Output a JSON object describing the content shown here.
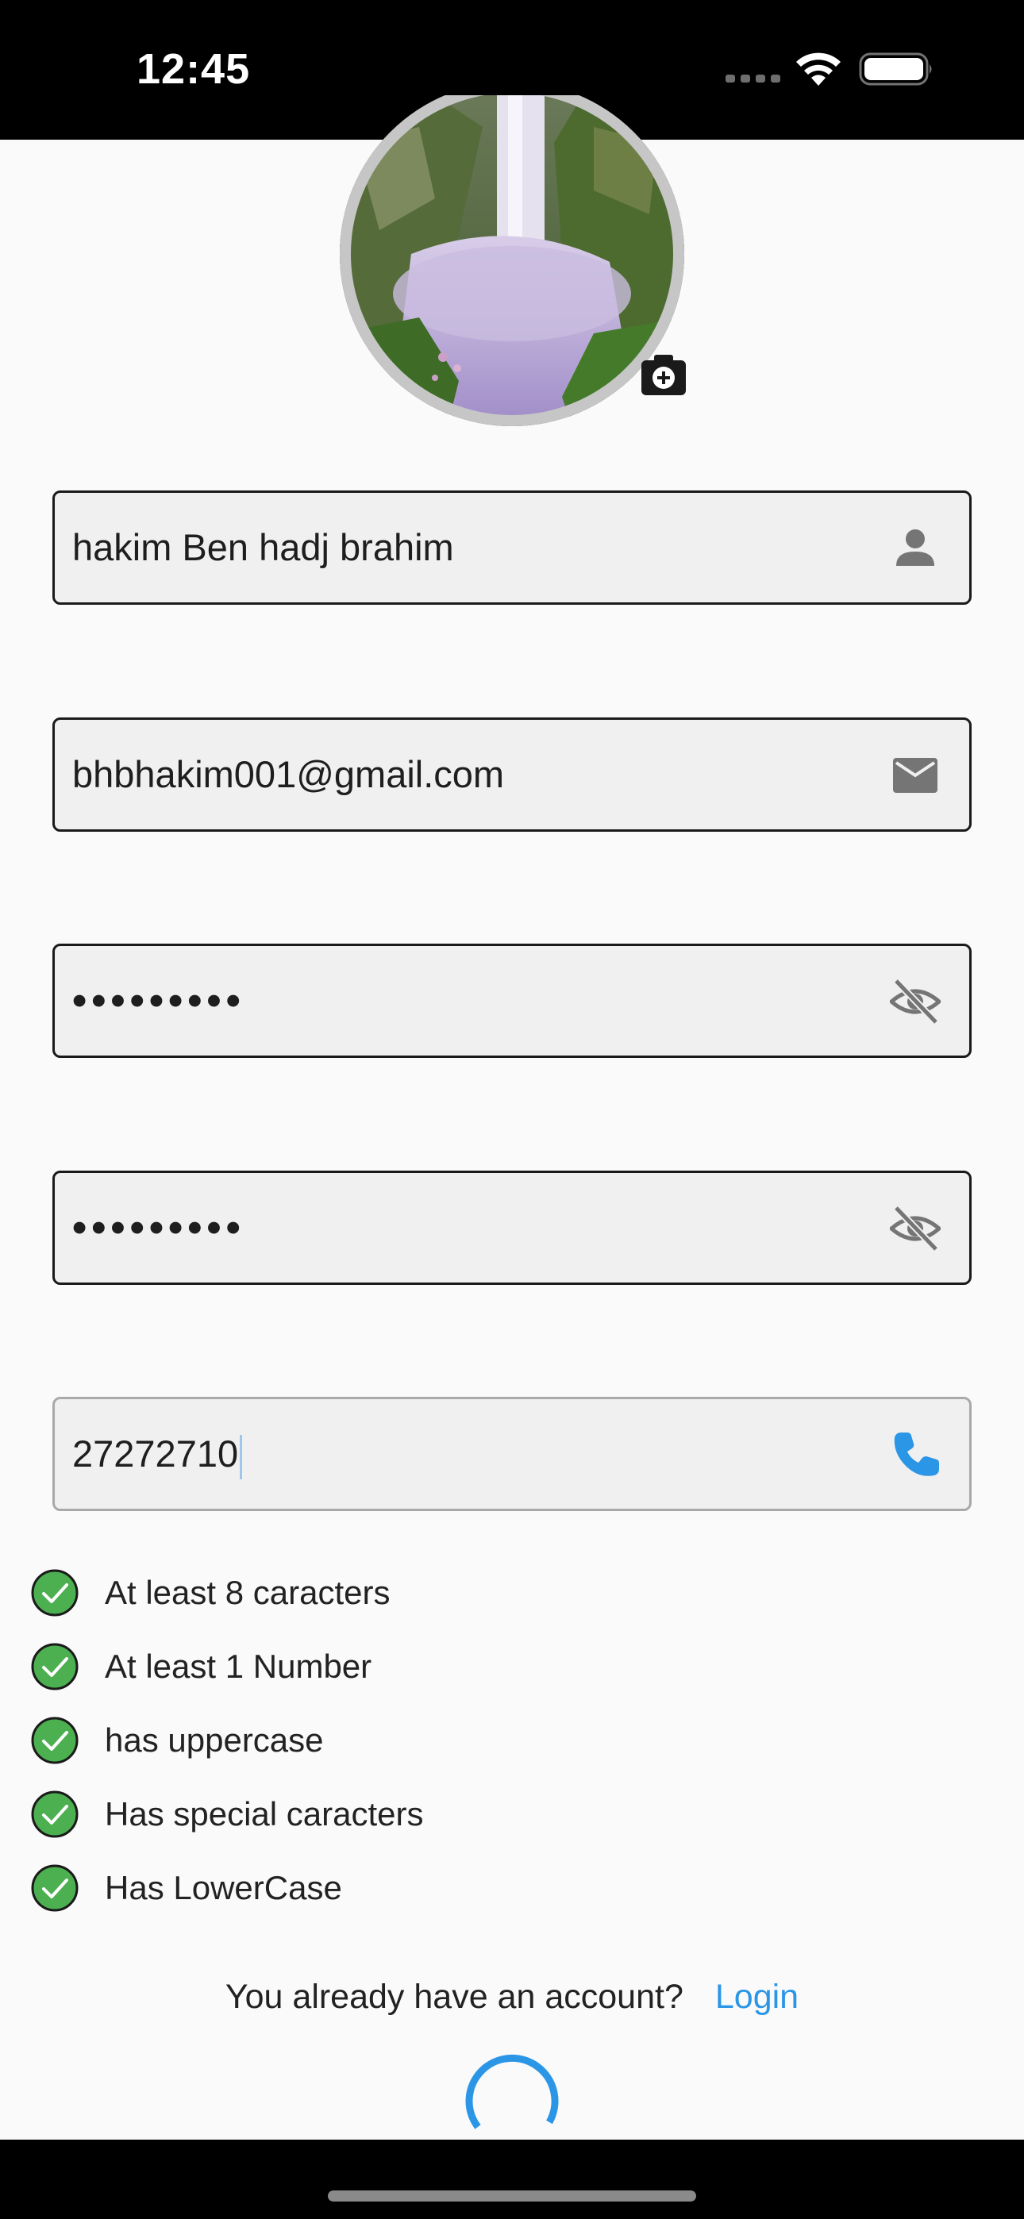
{
  "status_bar": {
    "time": "12:45"
  },
  "avatar": {
    "icon": "avatar-photo-waterfall",
    "badge_icon": "add-photo-camera-icon"
  },
  "form": {
    "fullname": {
      "value": "hakim Ben hadj brahim",
      "icon": "person-icon"
    },
    "email": {
      "value": "bhbhakim001@gmail.com",
      "icon": "mail-icon"
    },
    "password": {
      "value": "•••••••••",
      "icon": "eye-off-icon"
    },
    "confirm_password": {
      "value": "•••••••••",
      "icon": "eye-off-icon"
    },
    "phone": {
      "value": "27272710",
      "icon": "phone-icon"
    }
  },
  "password_rules": [
    {
      "label": "At least 8 caracters",
      "status": "met"
    },
    {
      "label": "At least 1 Number",
      "status": "met"
    },
    {
      "label": "has uppercase",
      "status": "met"
    },
    {
      "label": "Has special caracters",
      "status": "met"
    },
    {
      "label": "Has LowerCase",
      "status": "met"
    }
  ],
  "footer": {
    "question": "You already have an account?",
    "login_link": "Login"
  },
  "colors": {
    "accent": "#2c96e6",
    "success": "#4caf50",
    "field_background": "#f0f0f0",
    "page_background": "#fafafa"
  }
}
